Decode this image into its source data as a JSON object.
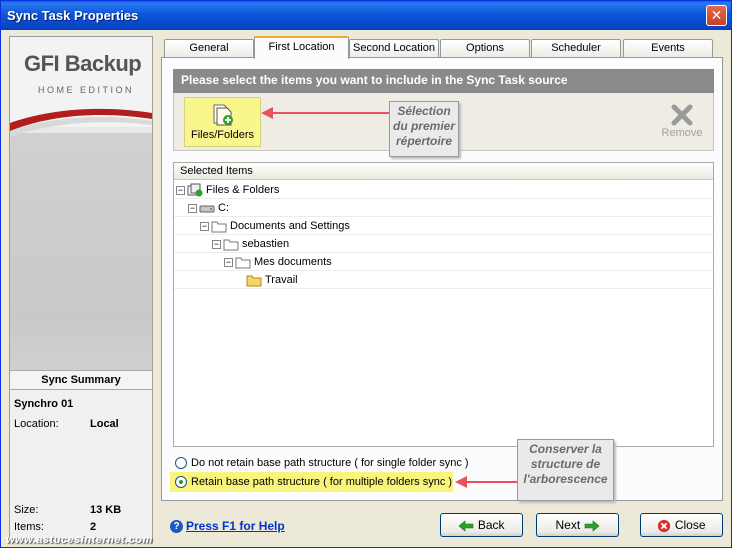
{
  "window": {
    "title": "Sync Task Properties"
  },
  "left": {
    "logo_brand": "GFI Backup",
    "logo_edition": "HOME EDITION",
    "summary_title": "Sync Summary",
    "task_name": "Synchro 01",
    "location_label": "Location:",
    "location_value": "Local",
    "size_label": "Size:",
    "size_value": "13 KB",
    "items_label": "Items:",
    "items_value": "2"
  },
  "tabs": [
    {
      "label": "General"
    },
    {
      "label": "First Location"
    },
    {
      "label": "Second Location"
    },
    {
      "label": "Options"
    },
    {
      "label": "Scheduler"
    },
    {
      "label": "Events"
    }
  ],
  "active_tab": "First Location",
  "instruction": "Please select the items you want to include in the Sync Task source",
  "toolbar": {
    "files_folders": "Files/Folders",
    "remove": "Remove"
  },
  "callouts": {
    "first": "Sélection du premier répertoire",
    "second": "Conserver la structure de l'arborescence"
  },
  "tree": {
    "header": "Selected Items",
    "nodes": [
      {
        "label": "Files & Folders"
      },
      {
        "label": "C:"
      },
      {
        "label": "Documents and Settings"
      },
      {
        "label": "sebastien"
      },
      {
        "label": "Mes documents"
      },
      {
        "label": "Travail"
      }
    ]
  },
  "options": {
    "no_retain": "Do not retain base path structure ( for single folder sync )",
    "retain": "Retain base path structure ( for multiple folders sync )",
    "selected": "retain"
  },
  "footer": {
    "help": "Press F1 for Help",
    "back": "Back",
    "next": "Next",
    "close": "Close"
  },
  "watermark": "www.astucesinternet.com",
  "colors": {
    "title_bar": "#0d55d9",
    "highlight": "#f8f47c",
    "callout_arrow": "#e8525a"
  }
}
